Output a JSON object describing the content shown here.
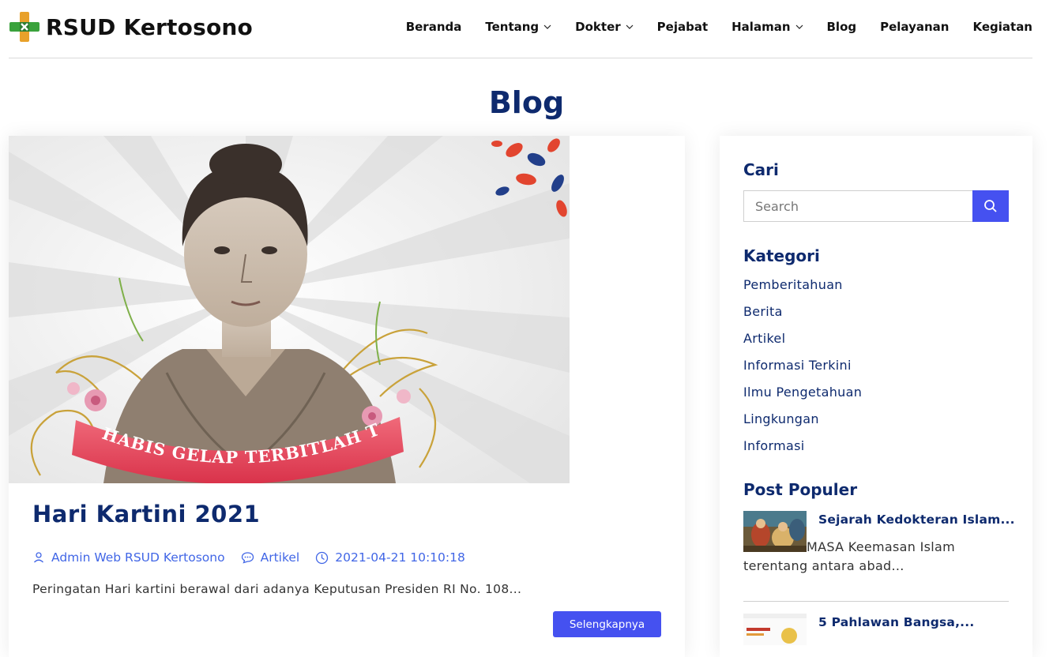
{
  "brand": {
    "name": "RSUD Kertosono"
  },
  "nav": {
    "items": [
      {
        "label": "Beranda",
        "dropdown": false
      },
      {
        "label": "Tentang",
        "dropdown": true
      },
      {
        "label": "Dokter",
        "dropdown": true
      },
      {
        "label": "Pejabat",
        "dropdown": false
      },
      {
        "label": "Halaman",
        "dropdown": true
      },
      {
        "label": "Blog",
        "dropdown": false
      },
      {
        "label": "Pelayanan",
        "dropdown": false
      },
      {
        "label": "Kegiatan",
        "dropdown": false
      }
    ]
  },
  "page": {
    "title": "Blog"
  },
  "post": {
    "image_caption": "HABIS GELAP TERBITLAH TERANG",
    "title": "Hari Kartini 2021",
    "author": "Admin Web RSUD Kertosono",
    "category": "Artikel",
    "datetime": "2021-04-21 10:10:18",
    "excerpt": "Peringatan Hari kartini berawal dari adanya Keputusan Presiden RI No. 108...",
    "read_more": "Selengkapnya"
  },
  "sidebar": {
    "search_heading": "Cari",
    "search_placeholder": "Search",
    "category_heading": "Kategori",
    "categories": [
      "Pemberitahuan",
      "Berita",
      "Artikel",
      "Informasi Terkini",
      "Ilmu Pengetahuan",
      "Lingkungan",
      "Informasi"
    ],
    "popular_heading": "Post Populer",
    "popular_posts": [
      {
        "title": "Sejarah Kedokteran Islam...",
        "excerpt_lead": "MASA",
        "excerpt_rest": " Keemasan Islam terentang antara abad..."
      },
      {
        "title": "5 Pahlawan Bangsa,..."
      }
    ]
  },
  "colors": {
    "heading": "#0e2a6e",
    "accent": "#4551f0",
    "link": "#4166e6",
    "logo_green": "#3aa23c",
    "logo_orange": "#e8a12a"
  },
  "icons": [
    "logo-cross-icon",
    "chevron-down-icon",
    "user-icon",
    "comment-icon",
    "clock-icon",
    "search-icon"
  ]
}
